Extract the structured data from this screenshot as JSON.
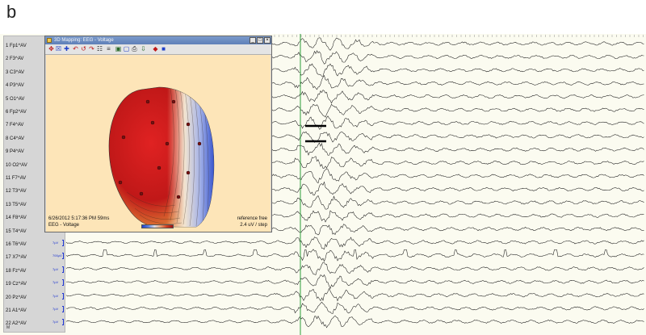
{
  "figure_label": "b",
  "viewer": {
    "channels": [
      {
        "label": "1 Fp1^AV"
      },
      {
        "label": "2 F3^AV"
      },
      {
        "label": "3 C3^AV"
      },
      {
        "label": "4 P3^AV"
      },
      {
        "label": "5 O1^AV"
      },
      {
        "label": "6 Fp2^AV"
      },
      {
        "label": "7 F4^AV"
      },
      {
        "label": "8 C4^AV"
      },
      {
        "label": "9 P4^AV"
      },
      {
        "label": "10 O2^AV"
      },
      {
        "label": "11 F7^AV"
      },
      {
        "label": "12 T3^AV"
      },
      {
        "label": "13 T5^AV"
      },
      {
        "label": "14 F8^AV"
      },
      {
        "label": "15 T4^AV"
      },
      {
        "label": "16 T6^AV",
        "scale": "7µV"
      },
      {
        "label": "17 X7^AV",
        "scale": "700µV"
      },
      {
        "label": "18 Fz^AV",
        "scale": "7µV"
      },
      {
        "label": "19 Cz^AV",
        "scale": "7µV"
      },
      {
        "label": "20 Pz^AV",
        "scale": "7µV"
      },
      {
        "label": "21 A1^AV",
        "scale": "7µV"
      },
      {
        "label": "22 A2^AV",
        "scale": "7µV"
      }
    ],
    "panel_footer": "M",
    "cursor_color": "#2e9c3a",
    "trace_color": "#1a1a1a"
  },
  "map_window": {
    "title": "3D Mapping: EEG - Voltage",
    "minimize": "_",
    "maximize": "□",
    "close": "×",
    "toolbar_icons": [
      "pointer-icon",
      "zoom-icon",
      "move-icon",
      "rotate-left-icon",
      "rotate-back-icon",
      "rotate-right-icon",
      "grid-icon",
      "layers-icon",
      "save-icon",
      "copy-icon",
      "print-icon",
      "export-icon",
      "palette-icon",
      "cube-icon"
    ],
    "timestamp": "6/26/2012 5:17:36 PM  59ms",
    "mode": "EEG - Voltage",
    "reference": "reference free",
    "step": "2.4 uV / step",
    "colors": {
      "positive": "#c81e1e",
      "negative": "#1f3fc9",
      "background": "#fde5b8"
    }
  }
}
